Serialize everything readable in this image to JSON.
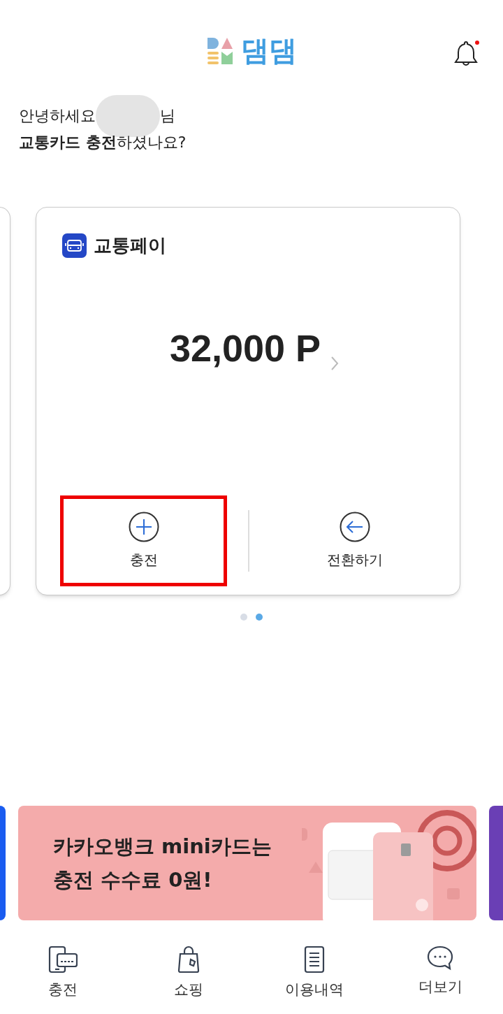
{
  "header": {
    "logo_text": "댐댐",
    "notification_dot": true
  },
  "greeting": {
    "prefix": "안녕하세요",
    "suffix": "님",
    "question": "**교통카드 충전**하셨나요?"
  },
  "card": {
    "title": "교통페이",
    "amount": "32,000 P",
    "actions": [
      {
        "label": "충전",
        "kind": "plus",
        "highlighted": true
      },
      {
        "label": "전환하기",
        "kind": "convert",
        "highlighted": false
      }
    ]
  },
  "pager": [
    {
      "selected": false
    },
    {
      "selected": true
    }
  ],
  "banner": {
    "lines": [
      "카카오뱅크 mini카드는",
      "충전 수수료 0원!"
    ]
  },
  "nav": [
    {
      "label": "충전",
      "kind": "charge"
    },
    {
      "label": "쇼핑",
      "kind": "shop"
    },
    {
      "label": "이용내역",
      "kind": "history"
    },
    {
      "label": "더보기",
      "kind": "more"
    }
  ]
}
